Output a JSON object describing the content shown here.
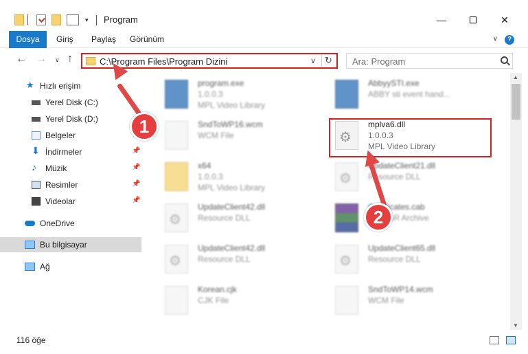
{
  "window": {
    "title": "Program",
    "minimize": "—",
    "close": "✕"
  },
  "ribbon": {
    "tabs": [
      "Dosya",
      "Giriş",
      "Paylaş",
      "Görünüm"
    ],
    "expand": "∨",
    "help": "?"
  },
  "nav": {
    "back": "←",
    "forward": "→",
    "recent": "∨",
    "up": "↑",
    "address": "C:\\Program Files\\Program Dizini",
    "address_dropdown": "∨",
    "refresh": "↻",
    "search_placeholder": "Ara: Program"
  },
  "sidebar": {
    "items": [
      {
        "label": "Hızlı erişim",
        "icon": "star-icon",
        "pinned": false
      },
      {
        "label": "Yerel Disk (C:)",
        "icon": "drive-icon",
        "pinned": false
      },
      {
        "label": "Yerel Disk (D:)",
        "icon": "drive-icon",
        "pinned": false
      },
      {
        "label": "Belgeler",
        "icon": "documents-icon",
        "pinned": true
      },
      {
        "label": "İndirmeler",
        "icon": "download-icon",
        "pinned": true
      },
      {
        "label": "Müzik",
        "icon": "music-icon",
        "pinned": true
      },
      {
        "label": "Resimler",
        "icon": "pictures-icon",
        "pinned": true
      },
      {
        "label": "Videolar",
        "icon": "video-icon",
        "pinned": true
      },
      {
        "label": "OneDrive",
        "icon": "cloud-icon",
        "pinned": false
      },
      {
        "label": "Bu bilgisayar",
        "icon": "computer-icon",
        "pinned": false,
        "selected": true
      },
      {
        "label": "Ağ",
        "icon": "network-icon",
        "pinned": false
      }
    ],
    "pin_glyph": "📌"
  },
  "files": [
    {
      "name": "program.exe",
      "line1": "1.0.0.3",
      "line2": "MPL Video Library",
      "icon": "exe-icon"
    },
    {
      "name": "AbbyySTI.exe",
      "line1": "ABBY sti event hand...",
      "line2": "",
      "icon": "exe-icon"
    },
    {
      "name": "SndToWP16.wcm",
      "line1": "WCM File",
      "line2": "",
      "icon": "file-icon"
    },
    {
      "name": "mplva6.dll",
      "line1": "1.0.0.3",
      "line2": "MPL Video Library",
      "icon": "dll-icon"
    },
    {
      "name": "x64",
      "line1": "1.0.0.3",
      "line2": "MPL Video Library",
      "icon": "folder-icon"
    },
    {
      "name": "UpdateClient21.dll",
      "line1": "Resource DLL",
      "line2": "",
      "icon": "dll-icon"
    },
    {
      "name": "UpdateClient42.dll",
      "line1": "Resource DLL",
      "line2": "",
      "icon": "dll-icon"
    },
    {
      "name": "Certificates.cab",
      "line1": "WinRAR Archive",
      "line2": "",
      "icon": "archive-icon"
    },
    {
      "name": "UpdateClient42.dll",
      "line1": "Resource DLL",
      "line2": "",
      "icon": "dll-icon"
    },
    {
      "name": "UpdateClient65.dll",
      "line1": "Resource DLL",
      "line2": "",
      "icon": "dll-icon"
    },
    {
      "name": "Korean.cjk",
      "line1": "CJK File",
      "line2": "",
      "icon": "file-icon"
    },
    {
      "name": "SndToWP14.wcm",
      "line1": "WCM File",
      "line2": "",
      "icon": "file-icon"
    }
  ],
  "annotations": {
    "step1": "1",
    "step2": "2"
  },
  "status": {
    "count": "116 öğe"
  },
  "colors": {
    "accent": "#1979ca",
    "highlight": "#d6201f",
    "arrow": "#e04848"
  }
}
